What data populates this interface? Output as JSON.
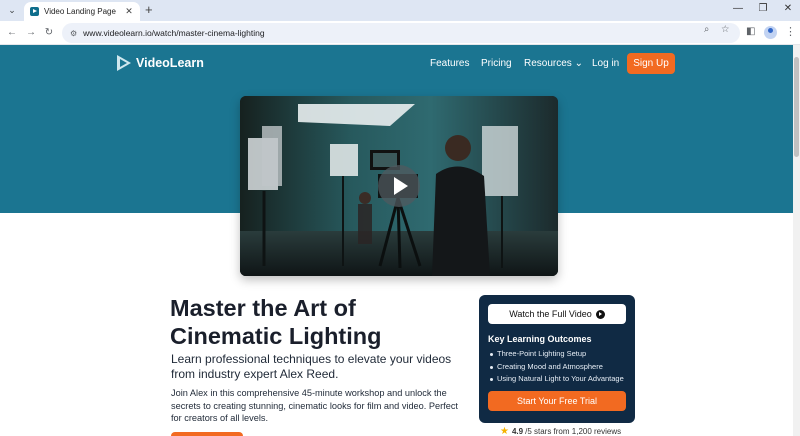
{
  "browser": {
    "tab_title": "Video Landing Page",
    "tab_close": "✕",
    "new_tab": "+",
    "tab_menu": "⌄",
    "window_controls": {
      "minimize": "—",
      "restore": "❐",
      "close": "✕"
    },
    "url": "www.videolearn.io/watch/master-cinema-lighting",
    "nav": {
      "back": "←",
      "forward": "→",
      "reload": "↻"
    },
    "icons": {
      "site_info": "site-info-icon",
      "zoom": "zoom-icon",
      "bookmark": "star-icon",
      "sidepanel": "side-panel-icon",
      "profile": "profile-icon",
      "menu": "kebab-menu-icon"
    },
    "glyphs": {
      "site_info": "⚙",
      "zoom": "⌕",
      "bookmark": "☆",
      "sidepanel": "◧",
      "menu": "⋮"
    }
  },
  "site": {
    "brand": "VideoLearn",
    "nav": {
      "features": "Features",
      "pricing": "Pricing",
      "resources": "Resources",
      "resources_caret": "⌄",
      "login": "Log in",
      "signup": "Sign Up"
    },
    "colors": {
      "hero_band": "#1b7591",
      "accent": "#f26a21",
      "card": "#102a44"
    }
  },
  "video": {
    "play_icon": "play-icon"
  },
  "content": {
    "headline": "Master the Art of Cinematic Lighting",
    "subhead": "Learn professional techniques to elevate your videos from industry expert Alex Reed.",
    "body": "Join Alex in this comprehensive 45-minute workshop and unlock the secrets to creating stunning, cinematic looks for film and video. Perfect for creators of all levels."
  },
  "card": {
    "watch_label": "Watch the Full Video",
    "title": "Key Learning Outcomes",
    "outcomes": [
      "Three-Point Lighting Setup",
      "Creating Mood and Atmosphere",
      "Using Natural Light to Your Advantage"
    ],
    "trial_label": "Start Your Free Trial"
  },
  "rating": {
    "star": "★",
    "score": "4.9",
    "suffix": "/5 stars from 1,200 reviews"
  }
}
